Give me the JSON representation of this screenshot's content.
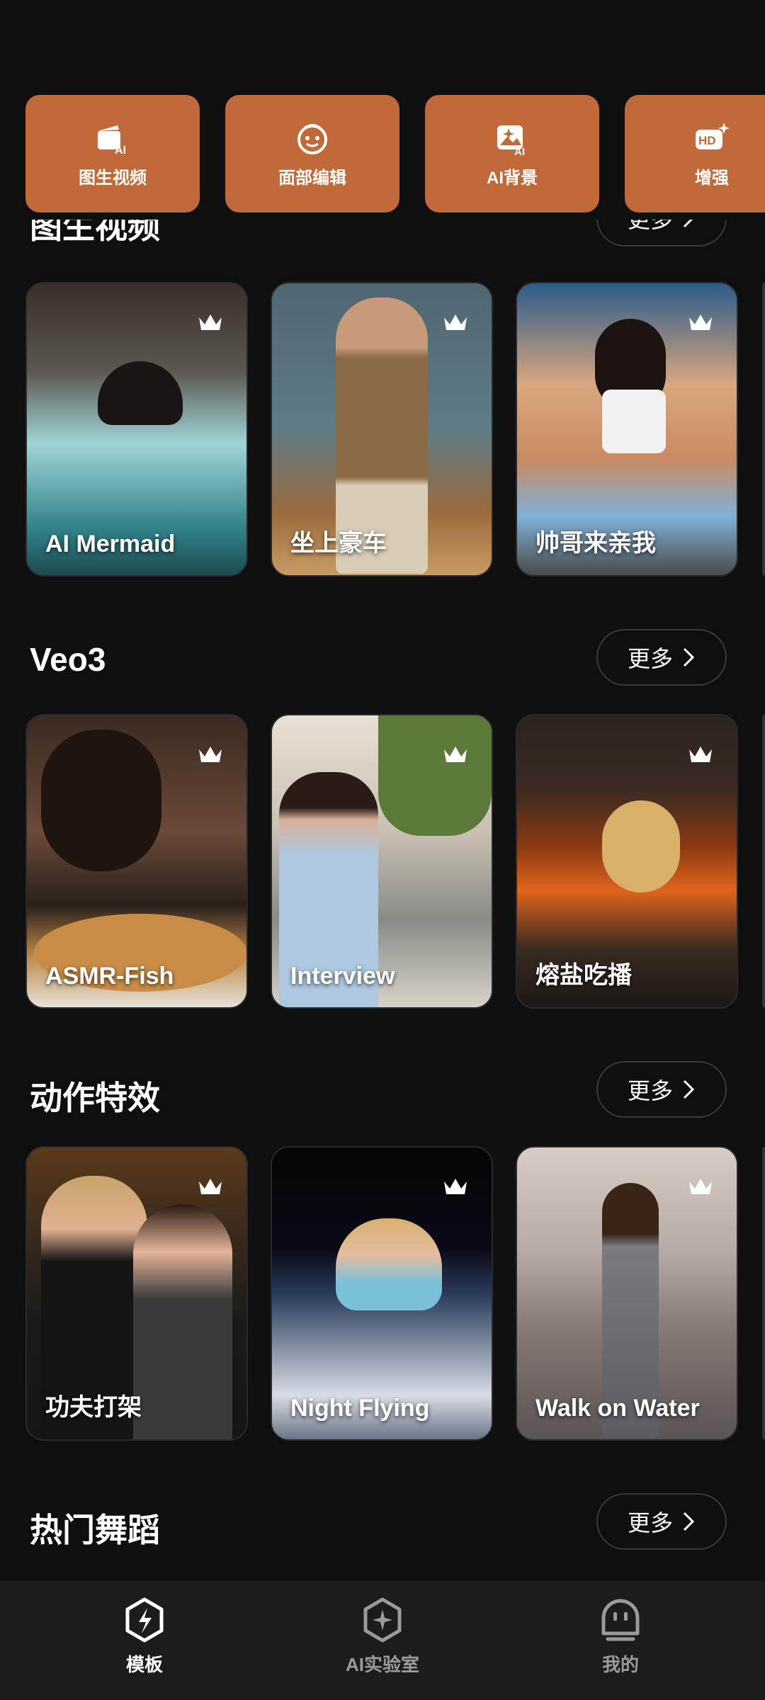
{
  "tools": [
    {
      "label": "图生视频",
      "icon": "image-to-video-icon"
    },
    {
      "label": "面部编辑",
      "icon": "face-edit-icon"
    },
    {
      "label": "AI背景",
      "icon": "ai-background-icon"
    },
    {
      "label": "增强",
      "icon": "hd-enhance-icon"
    }
  ],
  "sections": [
    {
      "title": "图生视频",
      "more": "更多",
      "cards": [
        {
          "title": "AI Mermaid"
        },
        {
          "title": "坐上豪车"
        },
        {
          "title": "帅哥来亲我"
        }
      ]
    },
    {
      "title": "Veo3",
      "more": "更多",
      "cards": [
        {
          "title": "ASMR-Fish"
        },
        {
          "title": "Interview"
        },
        {
          "title": "熔盐吃播"
        }
      ]
    },
    {
      "title": "动作特效",
      "more": "更多",
      "cards": [
        {
          "title": "功夫打架"
        },
        {
          "title": "Night Flying"
        },
        {
          "title": "Walk on Water"
        }
      ]
    },
    {
      "title": "热门舞蹈",
      "more": "更多",
      "cards": []
    }
  ],
  "nav": [
    {
      "label": "模板",
      "icon": "template-icon",
      "active": true
    },
    {
      "label": "AI实验室",
      "icon": "ai-lab-icon",
      "active": false
    },
    {
      "label": "我的",
      "icon": "profile-icon",
      "active": false
    }
  ],
  "colors": {
    "background": "#0f0f0f",
    "tool_tile": "#c2693a",
    "nav_bg": "#1c1c1c",
    "nav_inactive": "#9a9a9a"
  }
}
